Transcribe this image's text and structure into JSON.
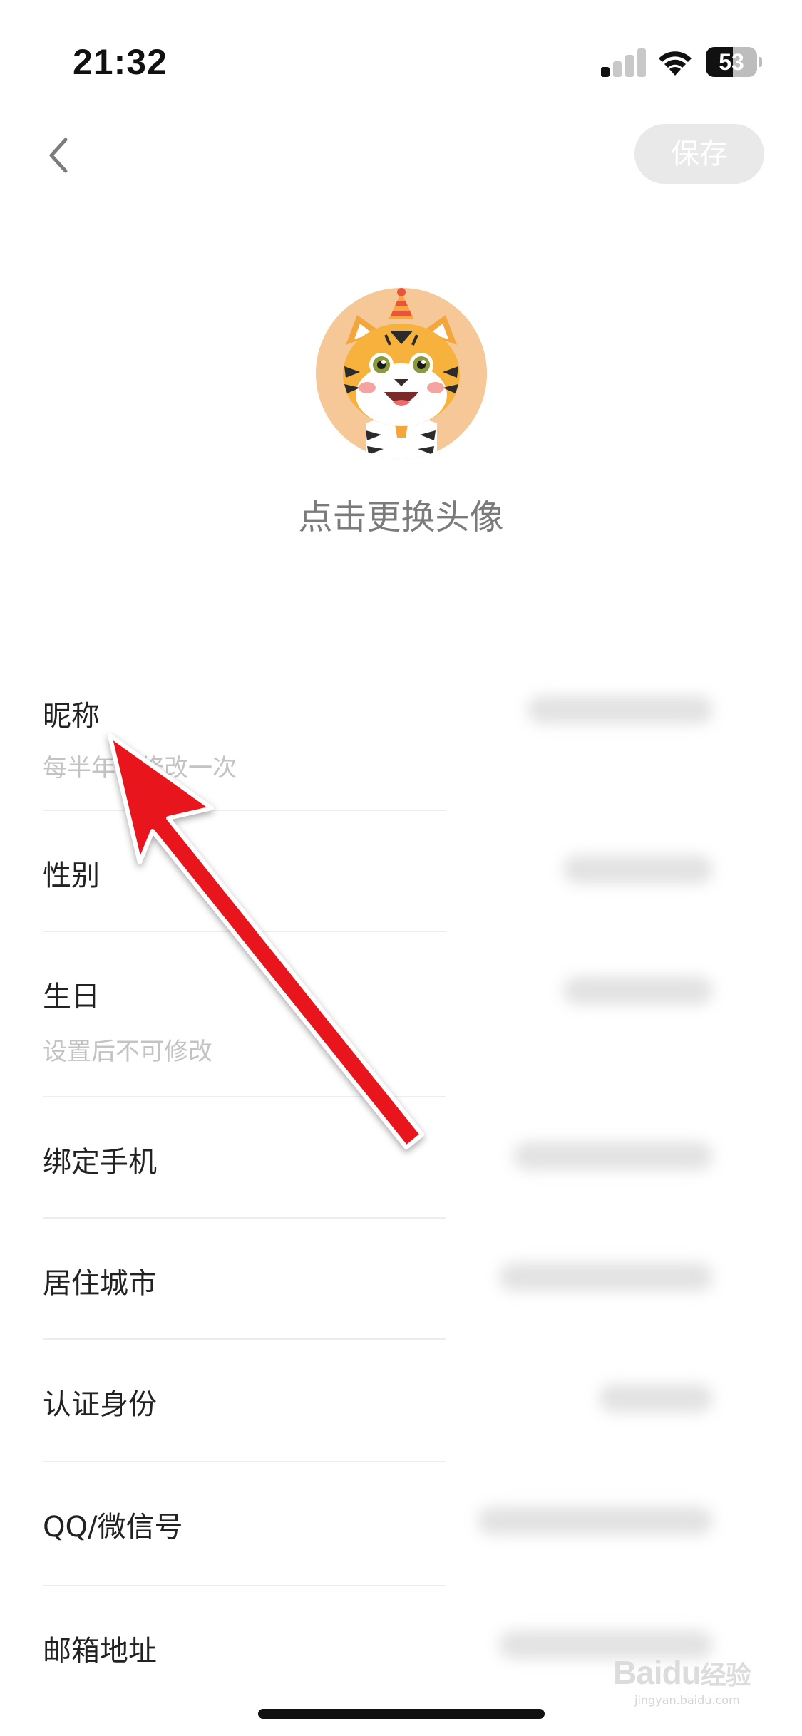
{
  "status_bar": {
    "time": "21:32",
    "battery_level": "53",
    "battery_fraction": 0.53,
    "signal_bars_active": 1,
    "signal_bars_total": 4
  },
  "nav": {
    "save_label": "保存"
  },
  "avatar": {
    "hint": "点击更换头像",
    "character": "tiger-avatar"
  },
  "form": {
    "rows": [
      {
        "label": "昵称",
        "sub": "每半年可修改一次"
      },
      {
        "label": "性别"
      },
      {
        "label": "生日",
        "sub": "设置后不可修改"
      },
      {
        "label": "绑定手机"
      },
      {
        "label": "居住城市"
      },
      {
        "label": "认证身份"
      },
      {
        "label": "QQ/微信号"
      },
      {
        "label": "邮箱地址"
      }
    ]
  },
  "annotation": {
    "color": "#e8141c"
  },
  "watermark": {
    "brand": "Bai",
    "brand_suffix": "du",
    "brand_cn": "经验",
    "site": "jingyan.baidu.com"
  },
  "colors": {
    "save_button_bg": "#e9e9ea",
    "hint_text": "#7b7b7b",
    "sub_text": "#c3c3c3"
  }
}
